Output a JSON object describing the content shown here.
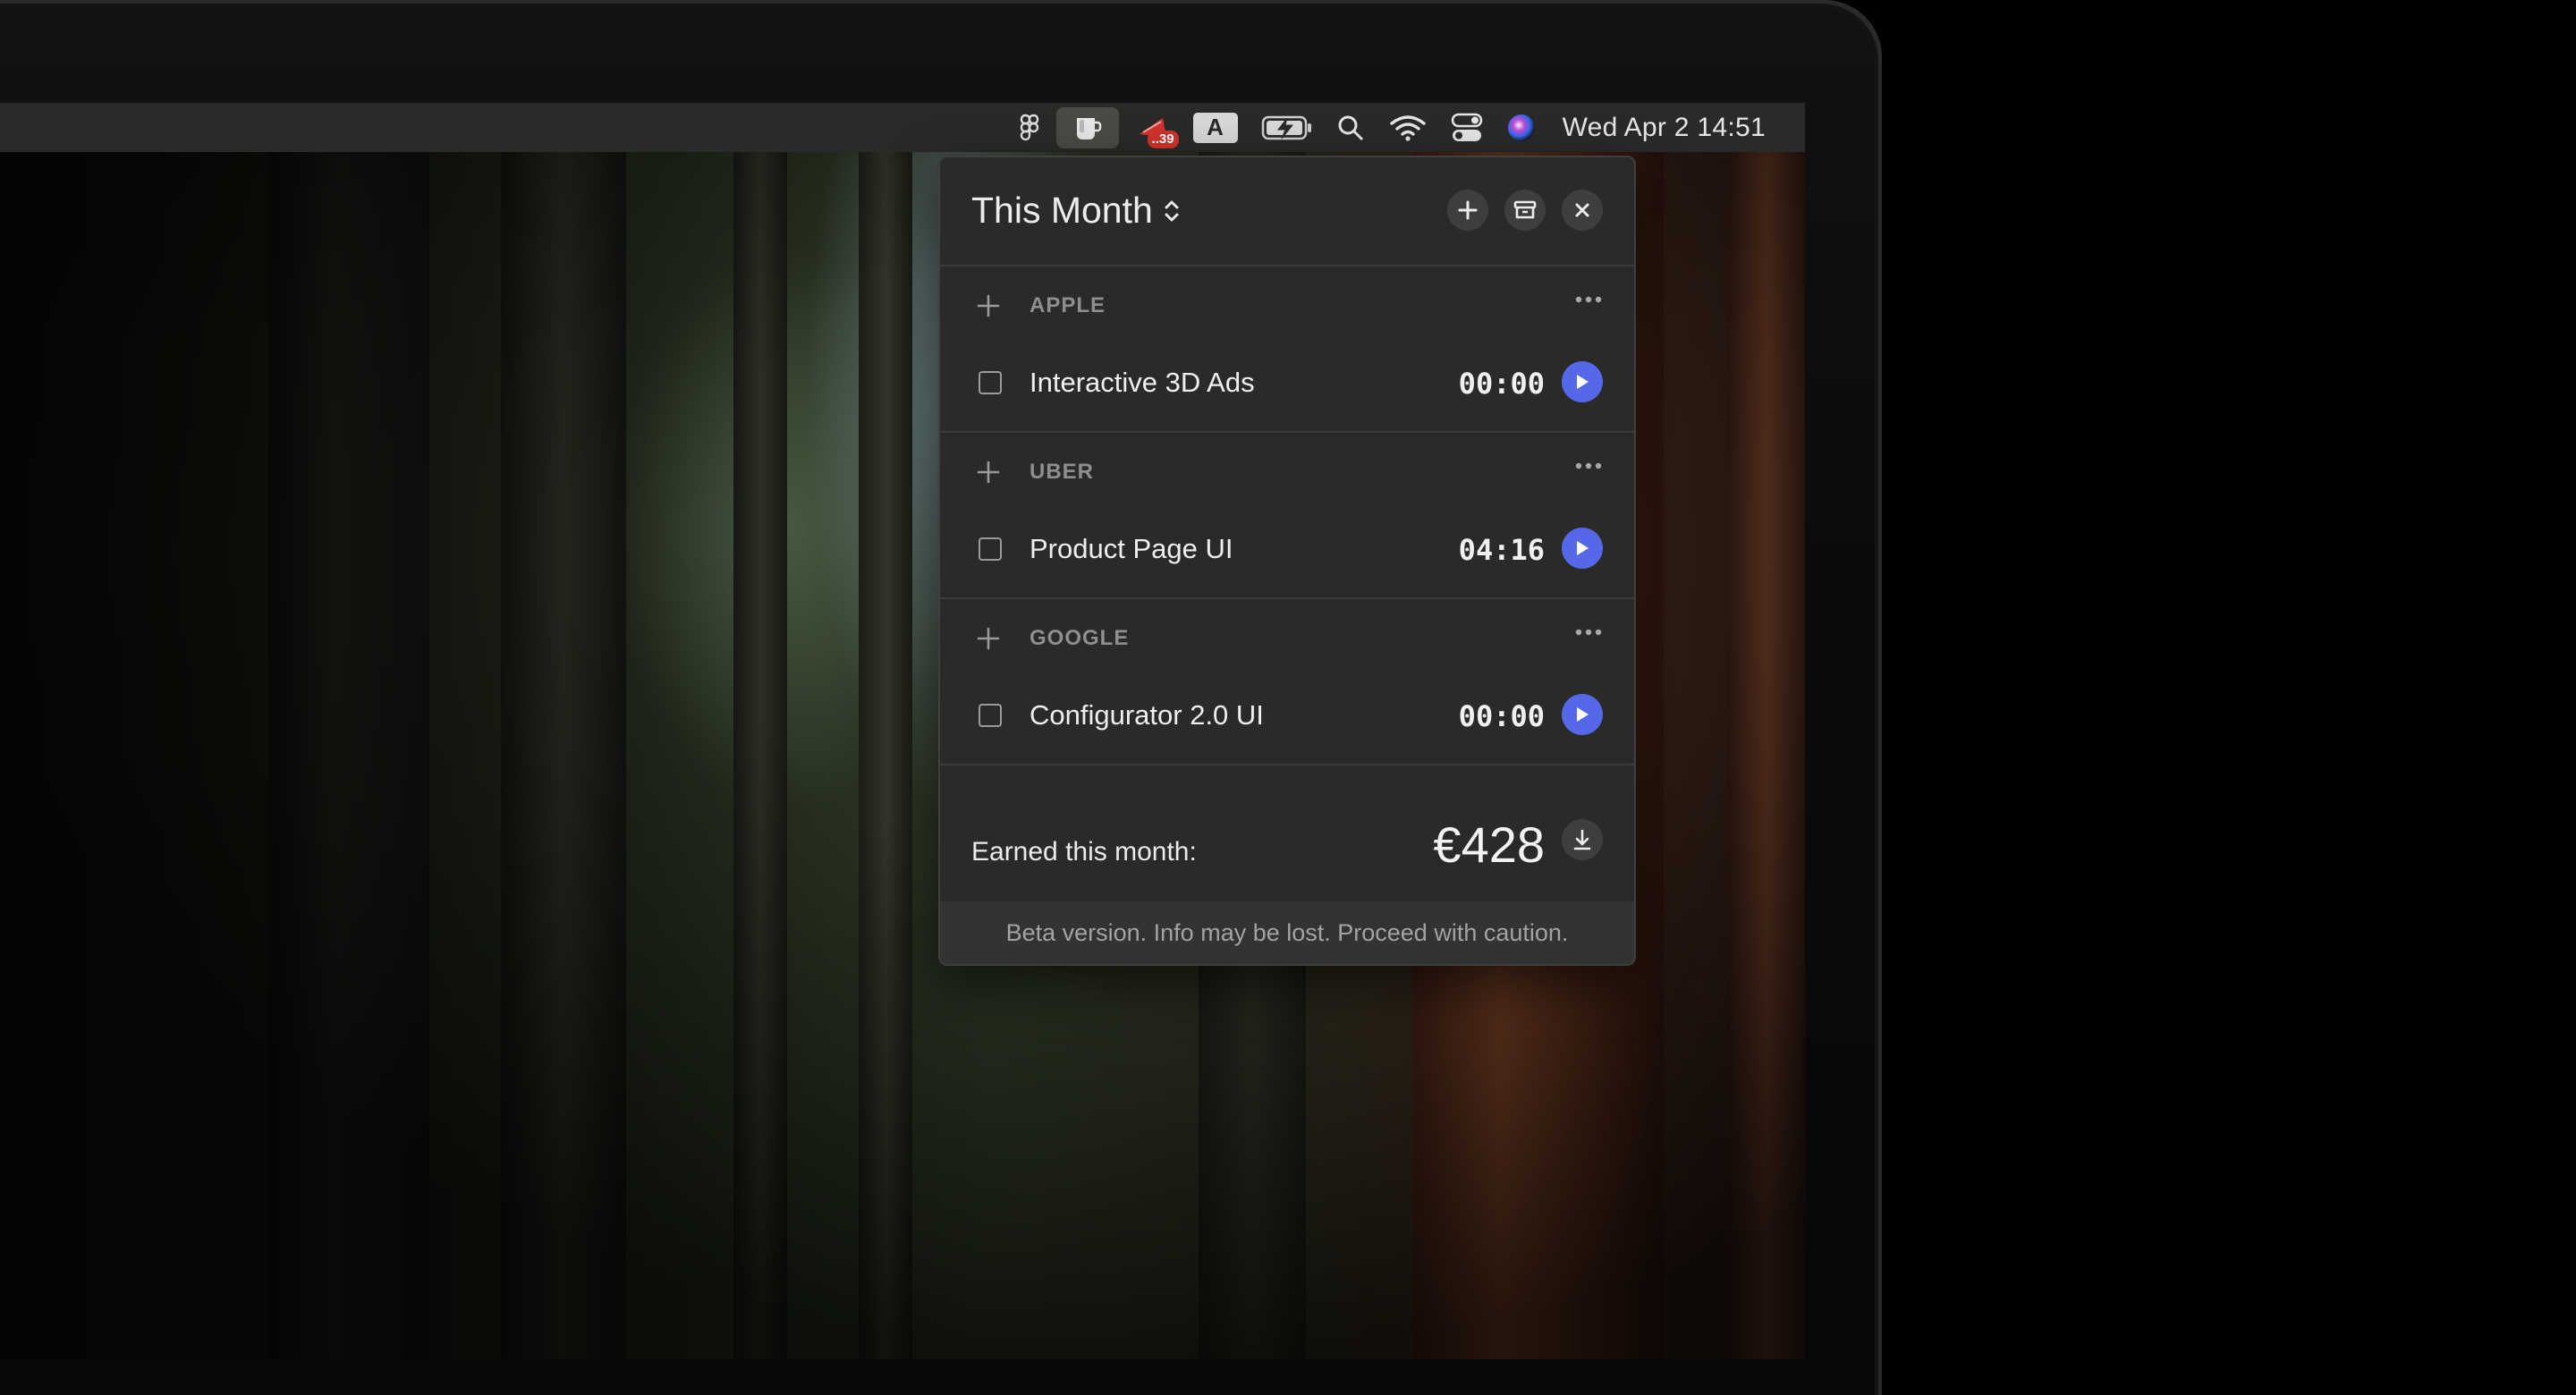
{
  "menubar": {
    "clock": "Wed Apr 2  14:51",
    "badge_count": "..39",
    "font_indicator": "A",
    "icons": [
      "figma-icon",
      "coffee-cup-icon",
      "notification-app-icon",
      "font-a-icon",
      "battery-charging-icon",
      "search-icon",
      "wifi-icon",
      "control-center-icon",
      "siri-icon"
    ]
  },
  "panel": {
    "title": "This Month",
    "groups": [
      {
        "name": "APPLE",
        "task": {
          "name": "Interactive 3D Ads",
          "time": "00:00"
        }
      },
      {
        "name": "UBER",
        "task": {
          "name": "Product Page UI",
          "time": "04:16"
        }
      },
      {
        "name": "GOOGLE",
        "task": {
          "name": "Configurator 2.0 UI",
          "time": "00:00"
        }
      }
    ],
    "earned_label": "Earned this month:",
    "earned_value": "€428",
    "footer": "Beta version. Info may be lost. Proceed with caution."
  },
  "colors": {
    "accent": "#5568e8",
    "panel_bg": "#2a2a29",
    "menubar_bg": "#2a2b28",
    "badge": "#d0342c"
  }
}
